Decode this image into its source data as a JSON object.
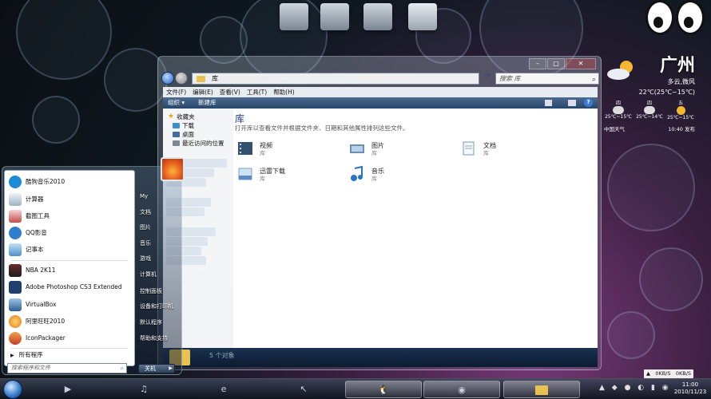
{
  "weather": {
    "city": "广州",
    "condition": "多云,微风",
    "temp": "22℃(25℃~15℃)",
    "days": [
      {
        "label": "四",
        "range": "25℃~15℃"
      },
      {
        "label": "四",
        "range": "25℃~14℃"
      },
      {
        "label": "五",
        "range": "25℃~15℃"
      }
    ],
    "source": "中国天气",
    "updated": "10:40 发布"
  },
  "explorer": {
    "address": "库",
    "search_placeholder": "搜索 库",
    "menu": [
      "文件(F)",
      "编辑(E)",
      "查看(V)",
      "工具(T)",
      "帮助(H)"
    ],
    "toolbar": {
      "organize": "组织 ▾",
      "new_library": "新建库"
    },
    "nav": {
      "favorites": "收藏夹",
      "downloads": "下载",
      "desktop": "桌面",
      "recent": "最近访问的位置"
    },
    "library_title": "库",
    "library_desc": "打开库以查看文件并根据文件夹、日期和其他属性排列这些文件。",
    "libraries": [
      {
        "name": "视频",
        "type": "库"
      },
      {
        "name": "图片",
        "type": "库"
      },
      {
        "name": "文档",
        "type": "库"
      },
      {
        "name": "迅雷下载",
        "type": "库"
      },
      {
        "name": "音乐",
        "type": "库"
      }
    ],
    "status": "5 个对象"
  },
  "start_menu": {
    "programs": [
      "酷狗音乐2010",
      "计算器",
      "截图工具",
      "QQ影音",
      "记事本",
      "NBA 2K11",
      "Adobe Photoshop CS3 Extended",
      "VirtualBox",
      "阿里旺旺2010",
      "IconPackager"
    ],
    "all_programs": "所有程序",
    "search_placeholder": "搜索程序和文件",
    "places": [
      "My",
      "文档",
      "图片",
      "音乐",
      "游戏",
      "计算机",
      "控制面板",
      "设备和打印机",
      "默认程序",
      "帮助和支持"
    ],
    "shutdown": "关机"
  },
  "taskbar": {
    "clock_time": "11:00",
    "clock_date": "2010/11/23",
    "net_up": "0KB/S",
    "net_down": "0KB/S"
  }
}
